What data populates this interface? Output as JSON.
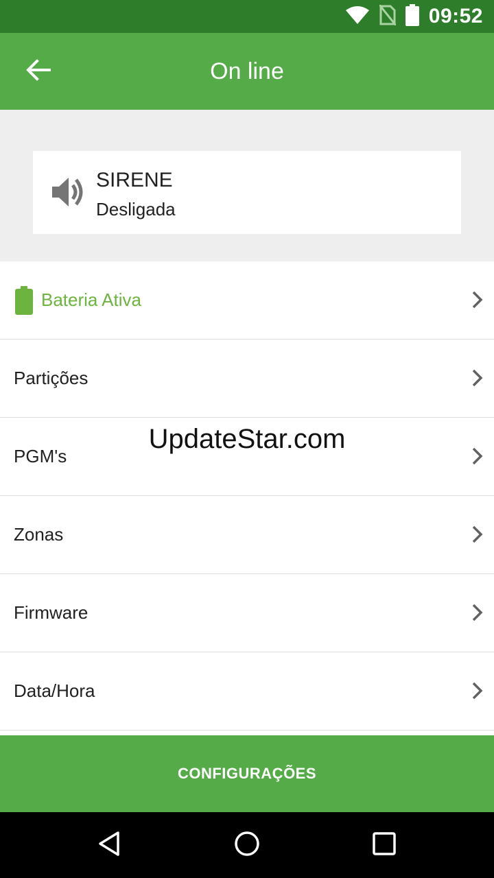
{
  "status_bar": {
    "time": "09:52",
    "icons": [
      "wifi-icon",
      "no-sim-icon",
      "battery-icon"
    ]
  },
  "app_bar": {
    "title": "On line",
    "back_icon": "arrow-back-icon"
  },
  "siren": {
    "title": "SIRENE",
    "status": "Desligada",
    "icon": "volume-icon"
  },
  "menu": {
    "items": [
      {
        "label": "Bateria Ativa",
        "icon": "battery-icon",
        "color": "#6db33f"
      },
      {
        "label": "Partições"
      },
      {
        "label": "PGM's"
      },
      {
        "label": "Zonas"
      },
      {
        "label": "Firmware"
      },
      {
        "label": "Data/Hora"
      }
    ]
  },
  "watermark": "UpdateStar.com",
  "footer": {
    "button_label": "CONFIGURAÇÕES"
  },
  "nav_bar": {
    "icons": [
      "back-triangle-icon",
      "home-circle-icon",
      "recents-square-icon"
    ]
  },
  "colors": {
    "status_bar": "#2e7d2a",
    "primary": "#55ab48",
    "accent_green": "#6db33f",
    "summary_background": "#eeeeee"
  }
}
